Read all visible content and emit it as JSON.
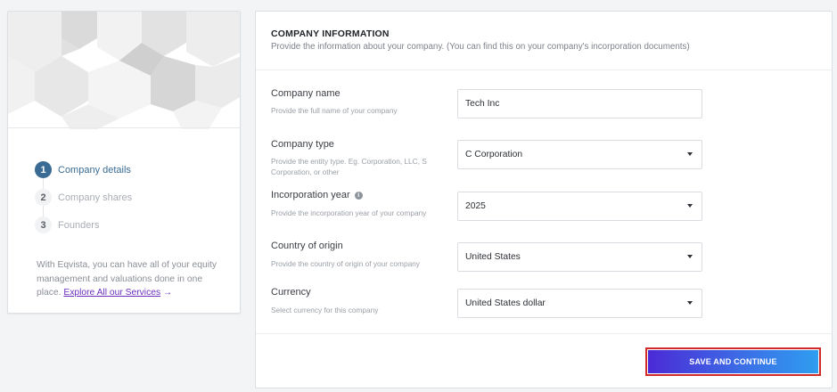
{
  "sidebar": {
    "steps": [
      {
        "number": "1",
        "label": "Company details",
        "state": "active"
      },
      {
        "number": "2",
        "label": "Company shares",
        "state": "inactive"
      },
      {
        "number": "3",
        "label": "Founders",
        "state": "inactive"
      }
    ],
    "promo_text": "With Eqvista, you can have all of your equity management and valuations done in one place.",
    "promo_link": "Explore All our Services"
  },
  "form": {
    "title": "COMPANY INFORMATION",
    "subtitle": "Provide the information about your company. (You can find this on your company's incorporation documents)",
    "fields": [
      {
        "label": "Company name",
        "help": "Provide the full name of your company",
        "value": "Tech Inc",
        "type": "input"
      },
      {
        "label": "Company type",
        "help": "Provide the entity type. Eg. Corporation, LLC, S Corporation, or other",
        "value": "C Corporation",
        "type": "select"
      },
      {
        "label": "Incorporation year",
        "help": "Provide the incorporation year of your company",
        "value": "2025",
        "type": "select",
        "has_info_icon": true,
        "info_icon": "i"
      },
      {
        "label": "Country of origin",
        "help": "Provide the country of origin of your company",
        "value": "United States",
        "type": "select"
      },
      {
        "label": "Currency",
        "help": "Select currency for this company",
        "value": "United States dollar",
        "type": "select"
      }
    ],
    "save_label": "SAVE AND CONTINUE"
  },
  "colors": {
    "accent": "#3a6b94",
    "link": "#6b2fbf",
    "button_gradient_start": "#4b2ad6",
    "button_gradient_end": "#2f9ef0",
    "highlight_border": "#d02a2a"
  }
}
